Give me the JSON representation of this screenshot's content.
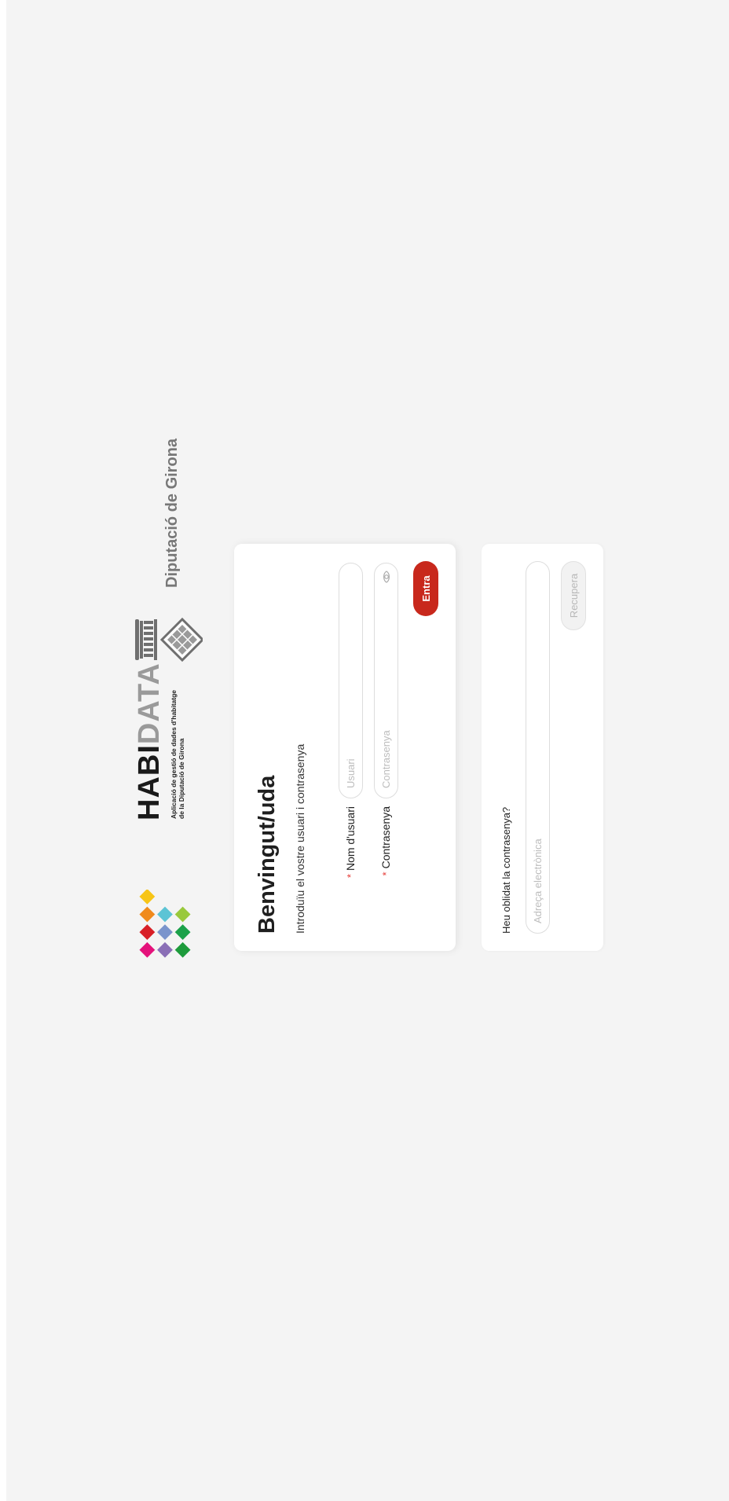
{
  "header": {
    "habidata_logo": {
      "word_part1": "HABI",
      "word_part2": "DATA",
      "subtitle_line1": "Aplicació de gestió de dades d'habitatge",
      "subtitle_line2": "de la Diputació de Girona"
    },
    "diputacio_logo": {
      "name": "Diputació de Girona"
    }
  },
  "login": {
    "title": "Benvingut/uda",
    "subtitle": "Introduïu el vostre usuari i contrasenya",
    "required_marker": "*",
    "username": {
      "label": "Nom d'usuari",
      "placeholder": "Usuari",
      "value": ""
    },
    "password": {
      "label": "Contrasenya",
      "placeholder": "Contrasenya",
      "value": "",
      "toggle_icon": "eye-icon"
    },
    "submit_label": "Entra"
  },
  "recover": {
    "label": "Heu oblidat la contrasenya?",
    "email_placeholder": "Adreça electrònica",
    "email_value": "",
    "submit_label": "Recupera"
  },
  "colors": {
    "page_background": "#f4f4f4",
    "card_background": "#ffffff",
    "primary_button": "#c8281c",
    "required_marker": "#e53935",
    "disabled_button_bg": "#f2f2f2",
    "disabled_button_text": "#b8b8b8"
  }
}
